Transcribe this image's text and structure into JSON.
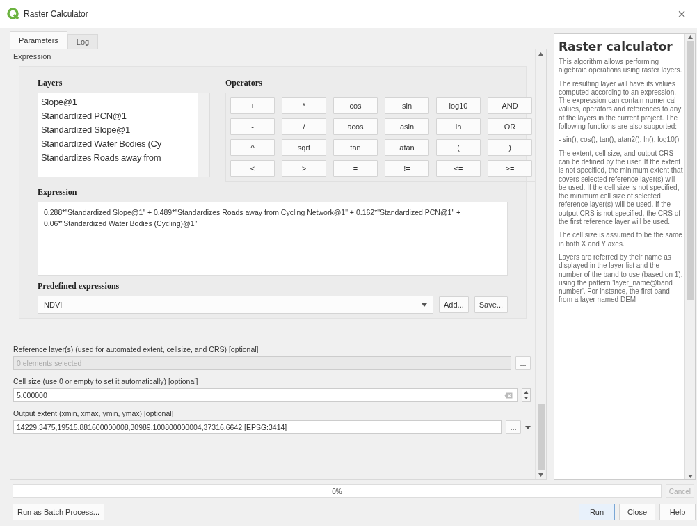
{
  "window": {
    "title": "Raster Calculator",
    "close": "×"
  },
  "tabs": [
    {
      "label": "Parameters",
      "selected": true
    },
    {
      "label": "Log",
      "selected": false
    }
  ],
  "group_title": "Expression",
  "layers": {
    "label": "Layers",
    "items": [
      "Slope@1",
      "Standardized PCN@1",
      "Standardized Slope@1",
      "Standardized Water Bodies (Cy",
      "Standardizes Roads away from"
    ]
  },
  "operators": {
    "label": "Operators",
    "rows": [
      [
        "+",
        "*",
        "cos",
        "sin",
        "log10",
        "AND"
      ],
      [
        "-",
        "/",
        "acos",
        "asin",
        "ln",
        "OR"
      ],
      [
        "^",
        "sqrt",
        "tan",
        "atan",
        "(",
        ")"
      ],
      [
        "<",
        ">",
        "=",
        "!=",
        "<=",
        ">="
      ]
    ]
  },
  "expression": {
    "label": "Expression",
    "value": "0.288*\"Standardized Slope@1\" + 0.489*\"Standardizes Roads away from Cycling Network@1\" + 0.162*\"Standardized PCN@1\" + 0.06*\"Standardized Water Bodies (Cycling)@1\""
  },
  "predefined": {
    "label": "Predefined expressions",
    "value": "NDVI",
    "buttons": [
      "Add...",
      "Save..."
    ]
  },
  "params": [
    {
      "kind": "layers",
      "label": "Reference layer(s) (used for automated extent, cellsize, and CRS) [optional]",
      "value": "0 elements selected",
      "disabled": true,
      "button": "..."
    },
    {
      "kind": "number",
      "label": "Cell size (use 0 or empty to set it automatically) [optional]",
      "value": "5.000000",
      "disabled": false
    },
    {
      "kind": "extent",
      "label": "Output extent (xmin, xmax, ymin, ymax) [optional]",
      "value": "14229.3475,19515.881600000008,30989.100800000004,37316.6642 [EPSG:3414]",
      "disabled": false,
      "button": "..."
    }
  ],
  "help": {
    "title": "Raster calculator",
    "paragraphs": [
      "This algorithm allows performing algebraic operations using raster layers.",
      "The resulting layer will have its values computed according to an expression. The expression can contain numerical values, operators and references to any of the layers in the current project. The following functions are also supported:",
      "- sin(), cos(), tan(), atan2(), ln(), log10()",
      "The extent, cell size, and output CRS can be defined by the user. If the extent is not specified, the minimum extent that covers selected reference layer(s) will be used. If the cell size is not specified, the minimum cell size of selected reference layer(s) will be used. If the output CRS is not specified, the CRS of the first reference layer will be used.",
      "The cell size is assumed to be the same in both X and Y axes.",
      "Layers are referred by their name as displayed in the layer list and the number of the band to use (based on 1), using the pattern 'layer_name@band number'. For instance, the first band from a layer named DEM"
    ]
  },
  "progress": {
    "level": 0,
    "reading": "0%"
  },
  "cancel": {
    "label": "Cancel",
    "disabled": true
  },
  "batch": "Run as Batch Process...",
  "buttons": [
    "Run",
    "Close",
    "Help"
  ]
}
